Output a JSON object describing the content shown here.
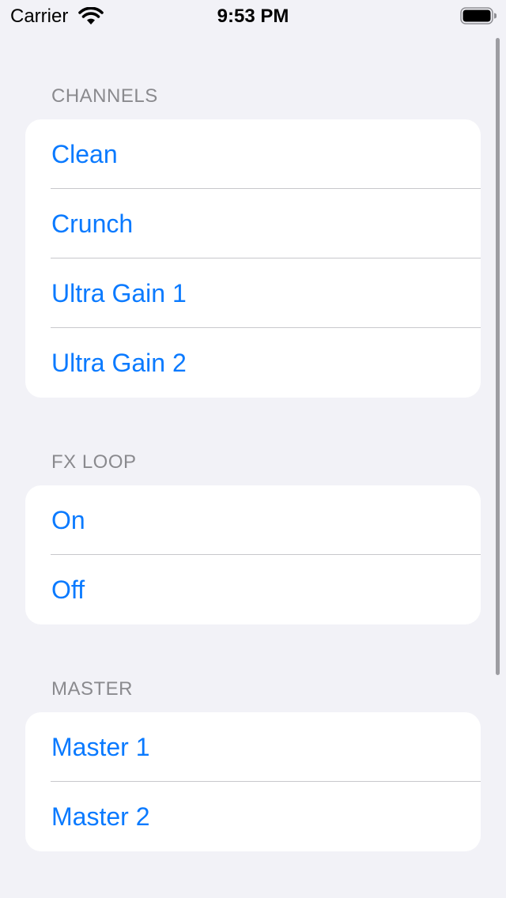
{
  "status_bar": {
    "carrier": "Carrier",
    "time": "9:53 PM",
    "wifi_icon": "wifi-icon",
    "battery_icon": "battery-icon"
  },
  "sections": {
    "channels": {
      "header": "CHANNELS",
      "items": [
        "Clean",
        "Crunch",
        "Ultra Gain 1",
        "Ultra Gain 2"
      ]
    },
    "fx_loop": {
      "header": "FX LOOP",
      "items": [
        "On",
        "Off"
      ]
    },
    "master": {
      "header": "MASTER",
      "items": [
        "Master 1",
        "Master 2"
      ]
    }
  },
  "colors": {
    "background": "#f2f2f7",
    "accent": "#0a7aff",
    "header_text": "#8a8a8e",
    "separator": "#c8c8cc"
  }
}
